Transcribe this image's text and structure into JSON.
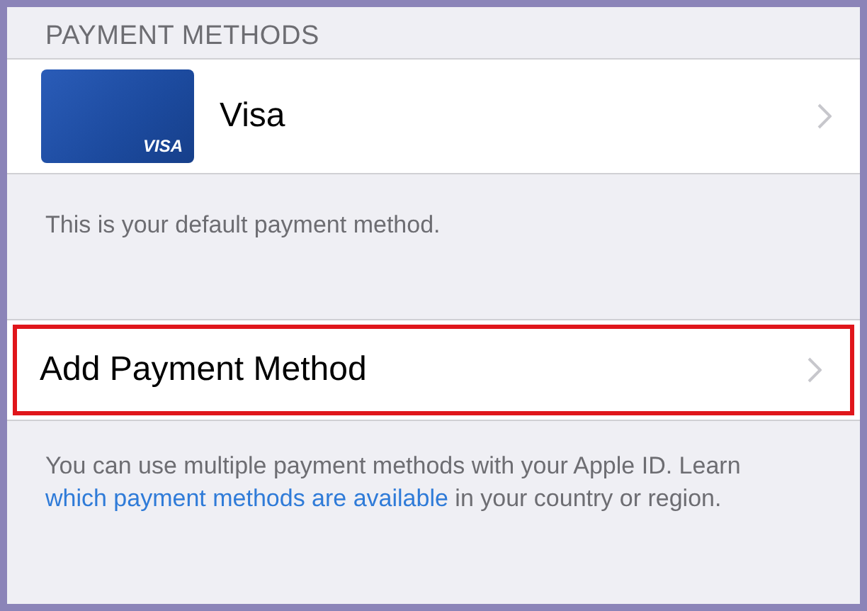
{
  "section_header": "PAYMENT METHODS",
  "payment_methods": [
    {
      "card_label": "VISA",
      "name": "Visa"
    }
  ],
  "default_note": "This is your default payment method.",
  "add_row": {
    "label": "Add Payment Method",
    "highlighted": true
  },
  "footer": {
    "text_before": "You can use multiple payment methods with your Apple ID. Learn ",
    "link": "which payment methods are available",
    "text_after": " in your country or region."
  }
}
